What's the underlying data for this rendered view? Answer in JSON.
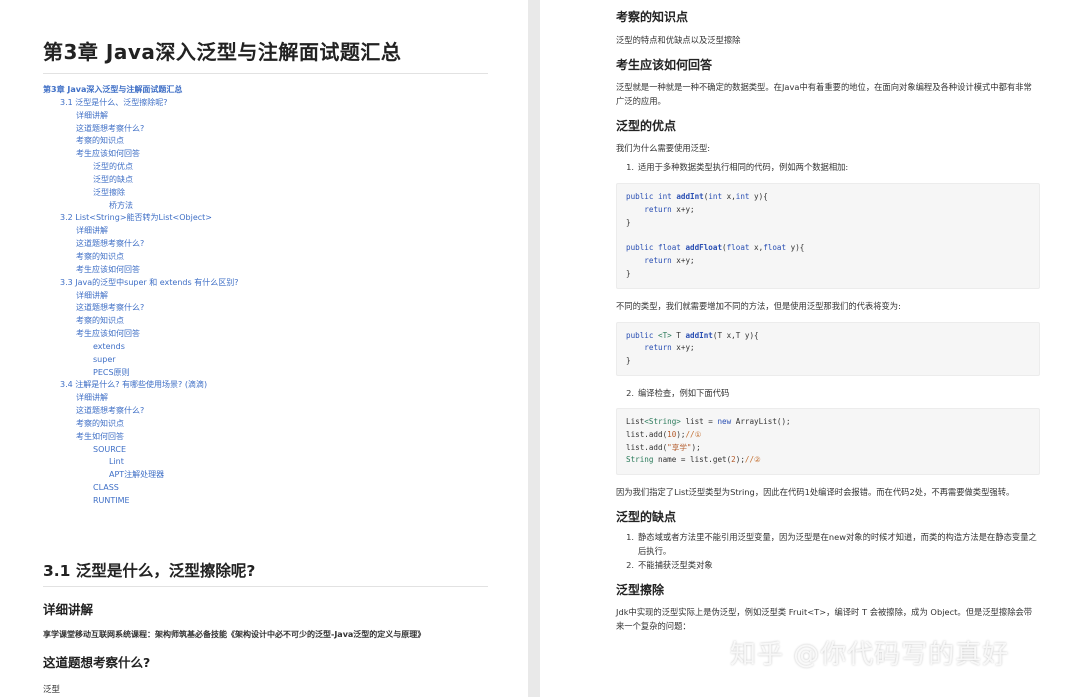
{
  "left": {
    "title": "第3章 Java深入泛型与注解面试题汇总",
    "toc": [
      {
        "level": 0,
        "text": "第3章 Java深入泛型与注解面试题汇总"
      },
      {
        "level": 1,
        "text": "3.1 泛型是什么、泛型擦除呢?"
      },
      {
        "level": 2,
        "text": "详细讲解"
      },
      {
        "level": 2,
        "text": "这道题想考察什么?"
      },
      {
        "level": 2,
        "text": "考察的知识点"
      },
      {
        "level": 2,
        "text": "考生应该如何回答"
      },
      {
        "level": 3,
        "text": "泛型的优点"
      },
      {
        "level": 3,
        "text": "泛型的缺点"
      },
      {
        "level": 3,
        "text": "泛型擦除"
      },
      {
        "level": 4,
        "text": "桥方法"
      },
      {
        "level": 1,
        "text": "3.2 List<String>能否转为List<Object>"
      },
      {
        "level": 2,
        "text": "详细讲解"
      },
      {
        "level": 2,
        "text": "这道题想考察什么?"
      },
      {
        "level": 2,
        "text": "考察的知识点"
      },
      {
        "level": 2,
        "text": "考生应该如何回答"
      },
      {
        "level": 1,
        "text": "3.3 Java的泛型中super 和 extends 有什么区别?"
      },
      {
        "level": 2,
        "text": "详细讲解"
      },
      {
        "level": 2,
        "text": "这道题想考察什么?"
      },
      {
        "level": 2,
        "text": "考察的知识点"
      },
      {
        "level": 2,
        "text": "考生应该如何回答"
      },
      {
        "level": 3,
        "text": "extends"
      },
      {
        "level": 3,
        "text": "super"
      },
      {
        "level": 3,
        "text": "PECS原则"
      },
      {
        "level": 1,
        "text": "3.4 注解是什么? 有哪些使用场景? (滴滴)"
      },
      {
        "level": 2,
        "text": "详细讲解"
      },
      {
        "level": 2,
        "text": "这道题想考察什么?"
      },
      {
        "level": 2,
        "text": "考察的知识点"
      },
      {
        "level": 2,
        "text": "考生如何回答"
      },
      {
        "level": 3,
        "text": "SOURCE"
      },
      {
        "level": 4,
        "text": "Lint"
      },
      {
        "level": 4,
        "text": "APT注解处理器"
      },
      {
        "level": 3,
        "text": "CLASS"
      },
      {
        "level": 3,
        "text": "RUNTIME"
      }
    ],
    "section_title": "3.1 泛型是什么，泛型擦除呢?",
    "detail_heading": "详细讲解",
    "course_text": "享学课堂移动互联网系统课程：架构师筑基必备技能《架构设计中必不可少的泛型-Java泛型的定义与原理》",
    "question_heading": "这道题想考察什么?",
    "question_answer": "泛型"
  },
  "right": {
    "h_knowledge": "考察的知识点",
    "p_knowledge": "泛型的特点和优缺点以及泛型擦除",
    "h_answer": "考生应该如何回答",
    "p_answer": "泛型就是一种就是一种不确定的数据类型。在Java中有着重要的地位，在面向对象编程及各种设计模式中都有非常广泛的应用。",
    "h_pros": "泛型的优点",
    "p_why": "我们为什么需要使用泛型:",
    "item1_num": "1.",
    "item1_text": "适用于多种数据类型执行相同的代码，例如两个数据相加:",
    "p_diff": "不同的类型，我们就需要增加不同的方法，但是使用泛型那我们的代表将变为:",
    "item2_num": "2.",
    "item2_text": "编译检查，例如下面代码",
    "p_because": "因为我们指定了List泛型类型为String，因此在代码1处编译时会报错。而在代码2处，不再需要做类型强转。",
    "h_cons": "泛型的缺点",
    "cons": [
      {
        "num": "1.",
        "text": "静态域或者方法里不能引用泛型变量，因为泛型是在new对象的时候才知道，而类的构造方法是在静态变量之后执行。"
      },
      {
        "num": "2.",
        "text": "不能捕获泛型类对象"
      }
    ],
    "h_erasure": "泛型擦除",
    "p_erasure": "Jdk中实现的泛型实际上是伪泛型，例如泛型类 Fruit<T>，编译时 T 会被擦除，成为 Object。但是泛型擦除会带来一个复杂的问题："
  },
  "watermark": "知乎 @你代码写的真好"
}
